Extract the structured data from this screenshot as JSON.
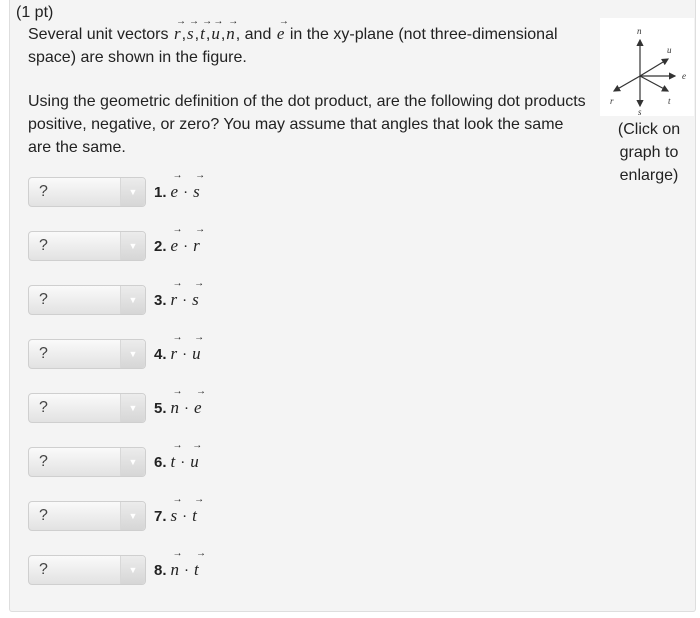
{
  "question": {
    "points": "(1 pt)",
    "intro_prefix": "Several unit vectors",
    "vectors": [
      "r",
      "s",
      "t",
      "u",
      "n",
      "e"
    ],
    "intro_and": "and",
    "intro_suffix": "in the xy-plane (not three-dimensional space) are shown in the figure.",
    "instructions": "Using the geometric definition of the dot product, are the following dot products positive, negative, or zero? You may assume that angles that look the same are the same."
  },
  "figure": {
    "caption": "(Click on graph to enlarge)",
    "vector_labels": {
      "n": "n",
      "u": "u",
      "e": "e",
      "t": "t",
      "s": "s",
      "r": "r"
    }
  },
  "select_placeholder": "?",
  "select_arrow_icon": "triangle-down",
  "items": [
    {
      "num": "1.",
      "a": "e",
      "b": "s",
      "value": "?"
    },
    {
      "num": "2.",
      "a": "e",
      "b": "r",
      "value": "?"
    },
    {
      "num": "3.",
      "a": "r",
      "b": "s",
      "value": "?"
    },
    {
      "num": "4.",
      "a": "r",
      "b": "u",
      "value": "?"
    },
    {
      "num": "5.",
      "a": "n",
      "b": "e",
      "value": "?"
    },
    {
      "num": "6.",
      "a": "t",
      "b": "u",
      "value": "?"
    },
    {
      "num": "7.",
      "a": "s",
      "b": "t",
      "value": "?"
    },
    {
      "num": "8.",
      "a": "n",
      "b": "t",
      "value": "?"
    }
  ],
  "dot_symbol": "·",
  "arrow_glyph": "▼"
}
